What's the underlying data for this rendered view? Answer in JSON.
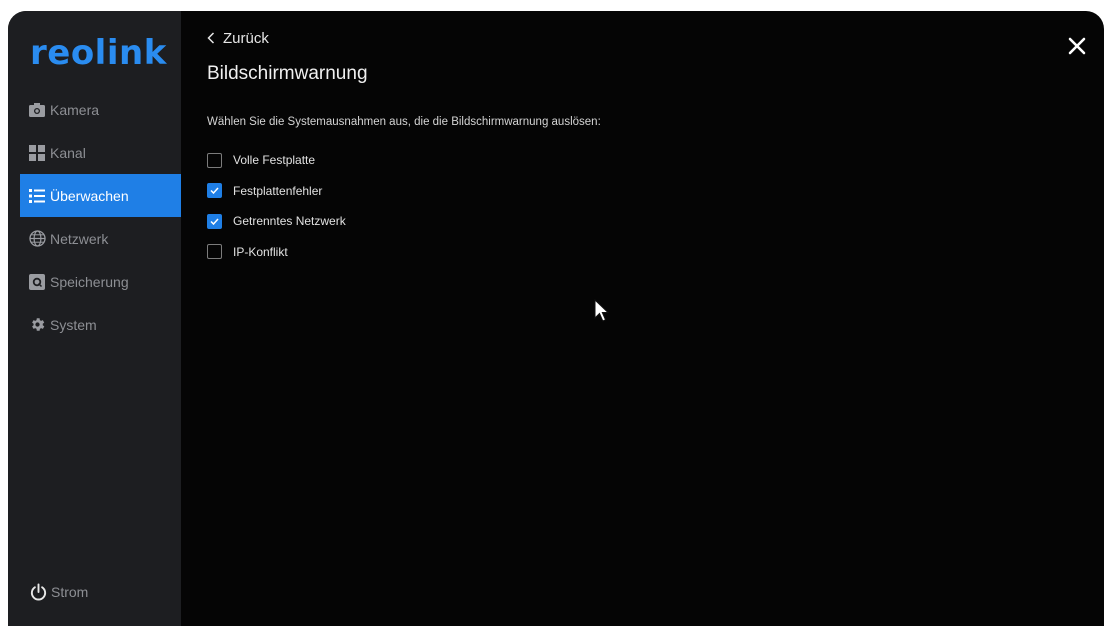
{
  "brand": {
    "logo_text": "reolink",
    "color": "#2a8cf0"
  },
  "sidebar": {
    "items": [
      {
        "label": "Kamera",
        "icon": "camera-icon",
        "active": false
      },
      {
        "label": "Kanal",
        "icon": "channel-grid-icon",
        "active": false
      },
      {
        "label": "Überwachen",
        "icon": "list-icon",
        "active": true
      },
      {
        "label": "Netzwerk",
        "icon": "globe-icon",
        "active": false
      },
      {
        "label": "Speicherung",
        "icon": "storage-icon",
        "active": false
      },
      {
        "label": "System",
        "icon": "gear-icon",
        "active": false
      }
    ],
    "power_label": "Strom",
    "active_color": "#1f7fe6"
  },
  "page": {
    "back_label": "Zurück",
    "title": "Bildschirmwarnung",
    "description": "Wählen Sie die Systemausnahmen aus, die die Bildschirmwarnung auslösen:",
    "options": [
      {
        "label": "Volle Festplatte",
        "checked": false
      },
      {
        "label": "Festplattenfehler",
        "checked": true
      },
      {
        "label": "Getrenntes Netzwerk",
        "checked": true
      },
      {
        "label": "IP-Konflikt",
        "checked": false
      }
    ]
  }
}
